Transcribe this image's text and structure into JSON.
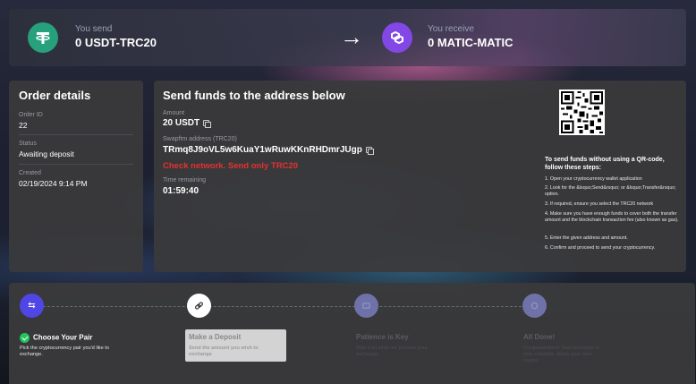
{
  "send": {
    "caption": "You send",
    "value": "0 USDT-TRC20",
    "icon": "tether-icon",
    "color": "#26a17b"
  },
  "receive": {
    "caption": "You receive",
    "value": "0 MATIC-MATIC",
    "icon": "polygon-icon",
    "color": "#8247e5"
  },
  "order": {
    "title": "Order details",
    "id_label": "Order ID",
    "id": "22",
    "status_label": "Status",
    "status": "Awaiting deposit",
    "created_label": "Created",
    "created": "02/19/2024 9:14 PM"
  },
  "funds": {
    "title": "Send funds to the address below",
    "amount_label": "Amount",
    "amount": "20 USDT",
    "address_label": "Swapftm address (TRC20)",
    "address": "TRmq8J9oVL5w6KuaY1wRuwKKnRHDmrJUgp",
    "warning": "Check network. Send only TRC20",
    "time_label": "Time remaining",
    "time": "01:59:40"
  },
  "instructions": {
    "title": "To send funds without using a QR-code, follow these steps:",
    "steps": [
      "1. Open your cryptocurrency wallet application",
      "2. Look for the &lsquo;Send&rsquo; or &lsquo;Transfer&rsquo; option.",
      "3. If required, ensure you select the TRC20 network",
      "4. Make sure you have enough funds to cover both the transfer amount and the blockchain transaction fee (also known as gas).",
      "5. Enter the given address and amount.",
      "6. Confirm and proceed to send your cryptocurrency."
    ]
  },
  "progress": {
    "stages": [
      {
        "title": "Choose Your Pair",
        "desc": "Pick the cryptocurrency pair you'd like to exchange.",
        "icon": "swap-icon",
        "state": "done"
      },
      {
        "title": "Make a Deposit",
        "desc": "Send the amount you wish to exchange",
        "icon": "link-icon",
        "state": "active"
      },
      {
        "title": "Patience is Key",
        "desc": "Wait a bit while we process your exchange.",
        "icon": "hourglass-icon",
        "state": "pending"
      },
      {
        "title": "All Done!",
        "desc": "Congratulations! Your exchange is now complete. Enjoy your new crypto!",
        "icon": "done-icon",
        "state": "pending"
      }
    ],
    "accent": "#4f46e5",
    "done_color": "#22c55e"
  }
}
